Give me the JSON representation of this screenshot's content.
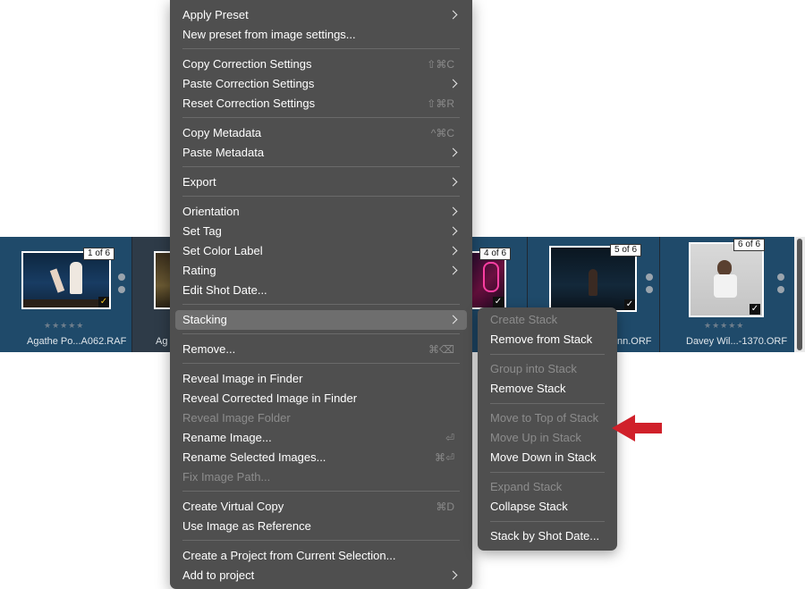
{
  "filmstrip": {
    "items": [
      {
        "badge": "1 of 6",
        "stars": "★★★★★",
        "filename": "Agathe Po...A062.RAF"
      },
      {
        "filename_partial": "Ag"
      },
      {
        "badge": "4 of 6"
      },
      {
        "badge": "5 of 6",
        "filename_partial": "nn.ORF"
      },
      {
        "badge": "6 of 6",
        "stars": "★★★★★",
        "filename": "Davey Wil...-1370.ORF"
      }
    ],
    "check_glyph": "✓"
  },
  "menu": {
    "items": [
      {
        "label": "Apply Preset",
        "submenu": true
      },
      {
        "label": "New preset from image settings..."
      },
      {
        "label": "Copy Correction Settings",
        "shortcut": "⇧⌘C"
      },
      {
        "label": "Paste Correction Settings",
        "submenu": true
      },
      {
        "label": "Reset Correction Settings",
        "shortcut": "⇧⌘R"
      },
      {
        "label": "Copy Metadata",
        "shortcut": "^⌘C"
      },
      {
        "label": "Paste Metadata",
        "submenu": true
      },
      {
        "label": "Export",
        "submenu": true
      },
      {
        "label": "Orientation",
        "submenu": true
      },
      {
        "label": "Set Tag",
        "submenu": true
      },
      {
        "label": "Set Color Label",
        "submenu": true
      },
      {
        "label": "Rating",
        "submenu": true
      },
      {
        "label": "Edit Shot Date..."
      },
      {
        "label": "Stacking",
        "submenu": true,
        "highlighted": true
      },
      {
        "label": "Remove...",
        "shortcut": "⌘⌫"
      },
      {
        "label": "Reveal Image in Finder"
      },
      {
        "label": "Reveal Corrected Image in Finder"
      },
      {
        "label": "Reveal Image Folder",
        "disabled": true
      },
      {
        "label": "Rename Image...",
        "shortcut": "⏎"
      },
      {
        "label": "Rename Selected Images...",
        "shortcut": "⌘⏎"
      },
      {
        "label": "Fix Image Path...",
        "disabled": true
      },
      {
        "label": "Create Virtual Copy",
        "shortcut": "⌘D"
      },
      {
        "label": "Use Image as Reference"
      },
      {
        "label": "Create a Project from Current Selection..."
      },
      {
        "label": "Add to project",
        "submenu": true
      }
    ]
  },
  "submenu": {
    "items": [
      {
        "label": "Create Stack",
        "disabled": true
      },
      {
        "label": "Remove from Stack"
      },
      {
        "label": "Group into Stack",
        "disabled": true
      },
      {
        "label": "Remove Stack"
      },
      {
        "label": "Move to Top of Stack",
        "disabled": true
      },
      {
        "label": "Move Up in Stack",
        "disabled": true
      },
      {
        "label": "Move Down in Stack"
      },
      {
        "label": "Expand Stack",
        "disabled": true
      },
      {
        "label": "Collapse Stack"
      },
      {
        "label": "Stack by Shot Date..."
      }
    ]
  },
  "colors": {
    "menu_bg": "#4f4f4f",
    "highlight": "#6e6e6e",
    "annotation_arrow": "#d0202a",
    "filmstrip_bg": "#2e3b48"
  }
}
